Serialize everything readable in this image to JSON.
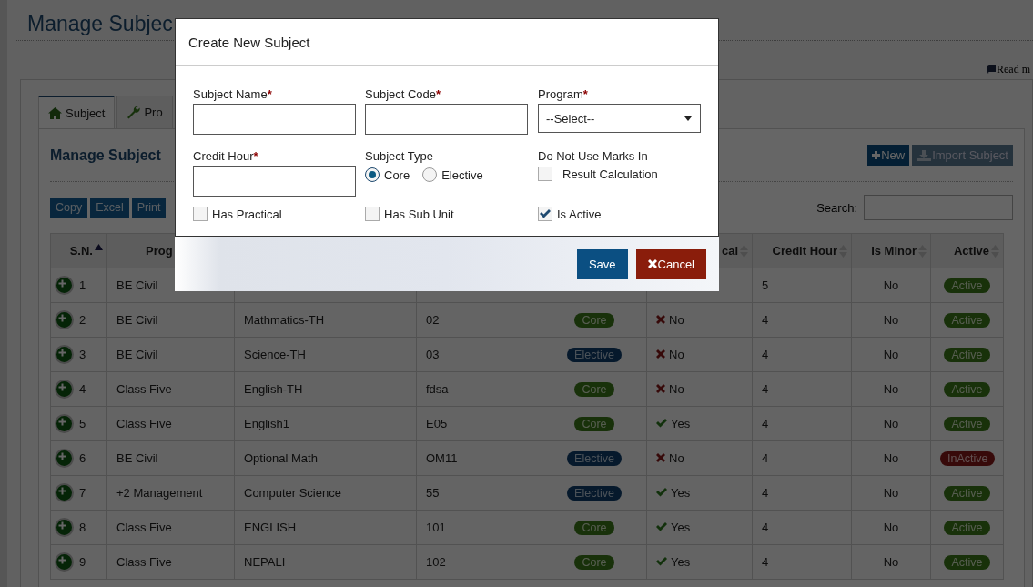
{
  "page": {
    "title": "Manage Subjec",
    "help_link": "Read m"
  },
  "tabs": [
    {
      "label": "Subject",
      "selected": true
    },
    {
      "label": "Pro",
      "selected": false
    }
  ],
  "panel": {
    "title": "Manage Subject",
    "actions": [
      {
        "label": "New",
        "disabled": false
      },
      {
        "label": "Import Subject",
        "disabled": true
      }
    ],
    "export_buttons": [
      "Copy",
      "Excel",
      "Print"
    ],
    "search": {
      "label": "Search:"
    }
  },
  "table": {
    "columns": [
      {
        "label": "S.N.",
        "sorted": true
      },
      {
        "label": "Prog"
      },
      {
        "label": "cal",
        "sorted": false
      },
      {
        "label": "Credit Hour",
        "sorted": false
      },
      {
        "label": "Is Minor",
        "sorted": false
      },
      {
        "label": "Active",
        "sorted": false
      }
    ],
    "rows": [
      {
        "sn": "1",
        "program": "BE Civil",
        "credit_hour": "5",
        "is_minor": "No",
        "status": {
          "label": "Active",
          "active": true
        }
      },
      {
        "sn": "2",
        "program": "BE Civil",
        "subject": "Mathmatics-TH",
        "code": "02",
        "type": {
          "label": "Core",
          "kind": "core"
        },
        "practical": {
          "label": "No",
          "yes": false
        },
        "credit_hour": "4",
        "is_minor": "No",
        "status": {
          "label": "Active",
          "active": true
        }
      },
      {
        "sn": "3",
        "program": "BE Civil",
        "subject": "Science-TH",
        "code": "03",
        "type": {
          "label": "Elective",
          "kind": "elective"
        },
        "practical": {
          "label": "No",
          "yes": false
        },
        "credit_hour": "4",
        "is_minor": "No",
        "status": {
          "label": "Active",
          "active": true
        }
      },
      {
        "sn": "4",
        "program": "Class Five",
        "subject": "English-TH",
        "code": "fdsa",
        "type": {
          "label": "Core",
          "kind": "core"
        },
        "practical": {
          "label": "No",
          "yes": false
        },
        "credit_hour": "4",
        "is_minor": "No",
        "status": {
          "label": "Active",
          "active": true
        }
      },
      {
        "sn": "5",
        "program": "Class Five",
        "subject": "English1",
        "code": "E05",
        "type": {
          "label": "Core",
          "kind": "core"
        },
        "practical": {
          "label": "Yes",
          "yes": true
        },
        "credit_hour": "4",
        "is_minor": "No",
        "status": {
          "label": "Active",
          "active": true
        }
      },
      {
        "sn": "6",
        "program": "BE Civil",
        "subject": "Optional Math",
        "code": "OM11",
        "type": {
          "label": "Elective",
          "kind": "elective"
        },
        "practical": {
          "label": "No",
          "yes": false
        },
        "credit_hour": "4",
        "is_minor": "No",
        "status": {
          "label": "InActive",
          "active": false
        }
      },
      {
        "sn": "7",
        "program": "+2 Management",
        "subject": "Computer Science",
        "code": "55",
        "type": {
          "label": "Elective",
          "kind": "elective"
        },
        "practical": {
          "label": "Yes",
          "yes": true
        },
        "credit_hour": "4",
        "is_minor": "No",
        "status": {
          "label": "Active",
          "active": true
        }
      },
      {
        "sn": "8",
        "program": "Class Five",
        "subject": "ENGLISH",
        "code": "101",
        "type": {
          "label": "Core",
          "kind": "core"
        },
        "practical": {
          "label": "Yes",
          "yes": true
        },
        "credit_hour": "4",
        "is_minor": "No",
        "status": {
          "label": "Active",
          "active": true
        }
      },
      {
        "sn": "9",
        "program": "Class Five",
        "subject": "NEPALI",
        "code": "102",
        "type": {
          "label": "Core",
          "kind": "core"
        },
        "practical": {
          "label": "Yes",
          "yes": true
        },
        "credit_hour": "4",
        "is_minor": "No",
        "status": {
          "label": "Active",
          "active": true
        }
      }
    ]
  },
  "modal": {
    "title": "Create New Subject",
    "fields": [
      {
        "kind": "text",
        "label": "Subject Name",
        "required_mark": "*"
      },
      {
        "kind": "text",
        "label": "Subject Code",
        "required_mark": "*"
      },
      {
        "kind": "select",
        "label": "Program",
        "required_mark": "*",
        "value": "--Select--"
      },
      {
        "kind": "text",
        "label": "Credit Hour",
        "required_mark": "*"
      },
      {
        "kind": "radio",
        "label": "Subject Type",
        "options": [
          {
            "label": "Core",
            "selected": true
          },
          {
            "label": "Elective",
            "selected": false
          }
        ]
      },
      {
        "kind": "checkgroup",
        "label": "Do Not Use Marks In",
        "option": {
          "label": "Result Calculation",
          "checked": false
        }
      },
      {
        "kind": "checkbox",
        "label": "Has Practical",
        "checked": false
      },
      {
        "kind": "checkbox",
        "label": "Has Sub Unit",
        "checked": false
      },
      {
        "kind": "checkbox",
        "label": "Is Active",
        "checked": true
      }
    ],
    "buttons": [
      {
        "label": "Save",
        "kind": "primary"
      },
      {
        "label": "Cancel",
        "kind": "danger"
      }
    ]
  }
}
